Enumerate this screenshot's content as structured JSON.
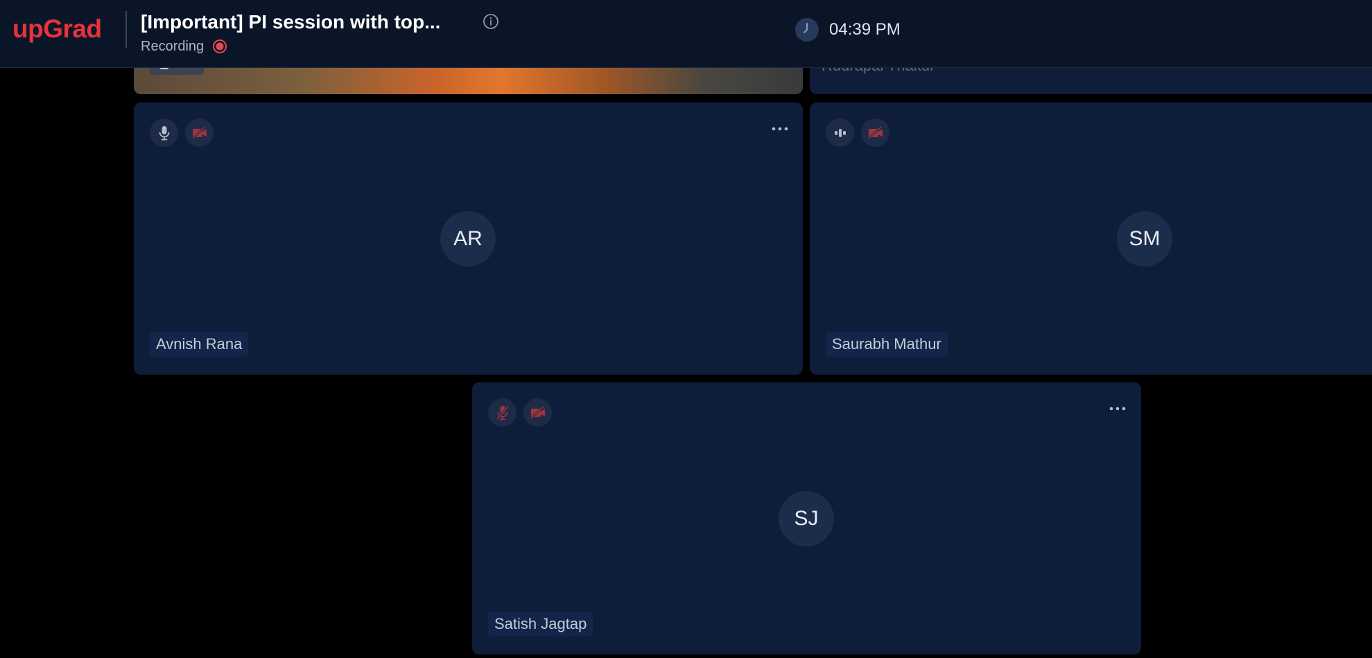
{
  "header": {
    "logo_text": "upGrad",
    "session_title": "[Important] PI session with top...",
    "recording_label": "Recording",
    "time": "04:39 PM"
  },
  "colors": {
    "brand_red": "#e8323c",
    "header_bg": "#0b1528",
    "tile_bg": "#0d1d3a",
    "muted_red_icon": "#a1333f",
    "recording_red": "#e5484d"
  },
  "tiles": {
    "you": {
      "label": "You"
    },
    "rudra": {
      "label": "Rudrapal Thakur"
    },
    "avnish": {
      "initials": "AR",
      "name": "Avnish Rana",
      "mic_icon": "microphone-icon",
      "cam_icon": "camera-off-icon"
    },
    "saurabh": {
      "initials": "SM",
      "name": "Saurabh Mathur",
      "mic_icon": "audio-level-icon",
      "cam_icon": "camera-off-icon"
    },
    "satish": {
      "initials": "SJ",
      "name": "Satish Jagtap",
      "mic_icon": "microphone-muted-icon",
      "cam_icon": "camera-off-icon"
    }
  }
}
